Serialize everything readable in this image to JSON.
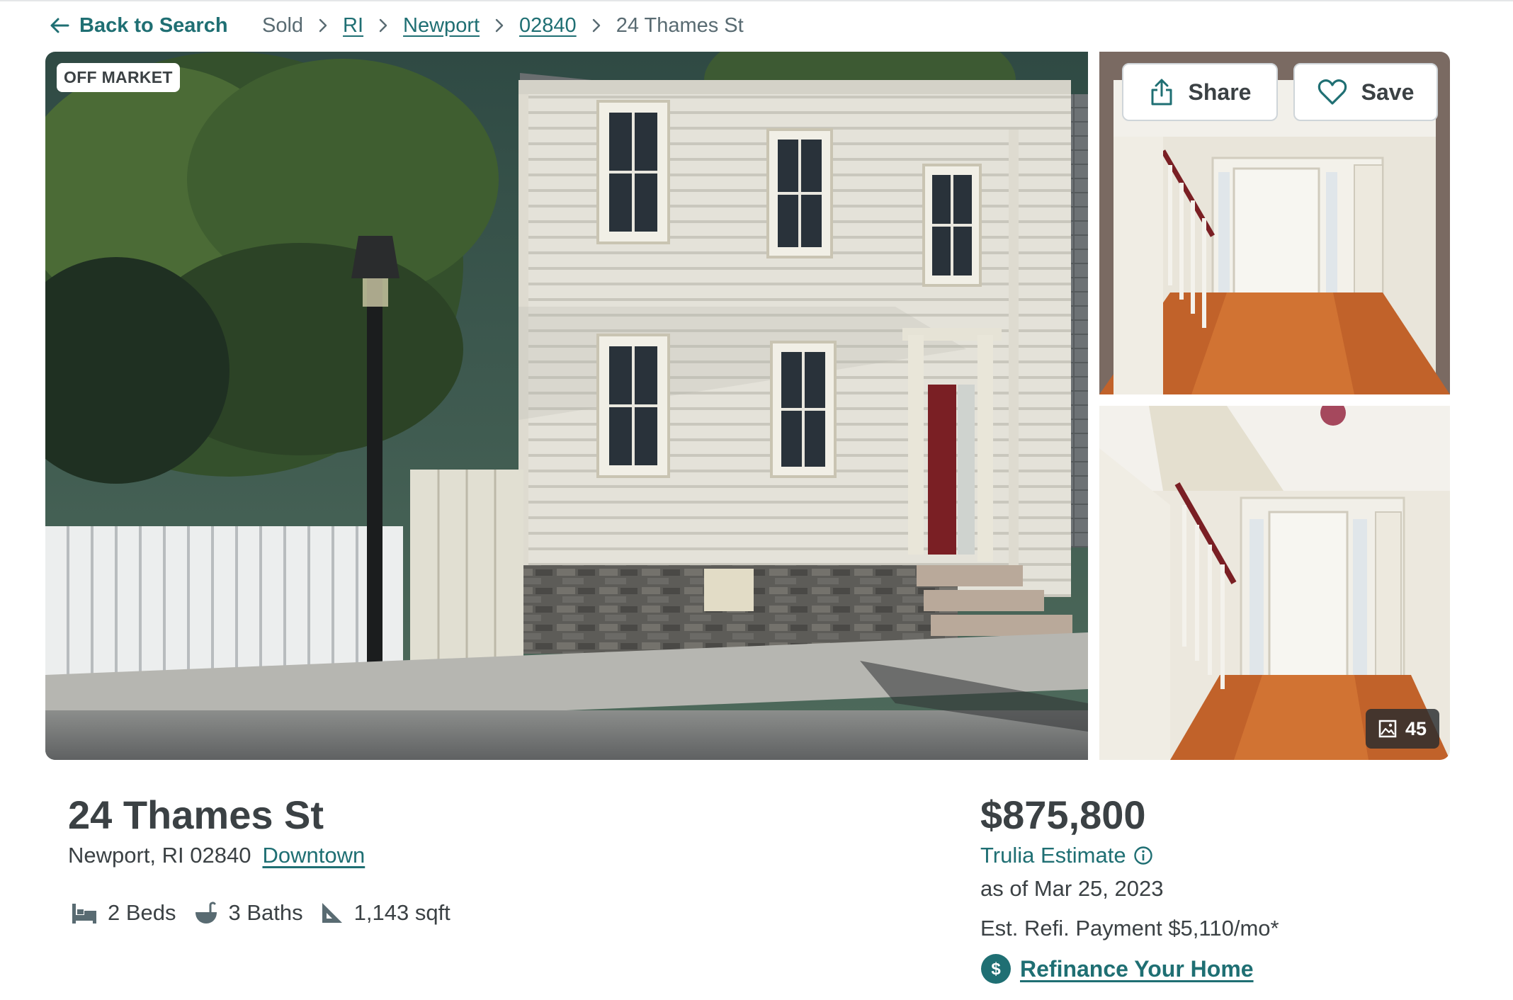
{
  "nav": {
    "back_label": "Back to Search",
    "breadcrumbs": [
      {
        "label": "Sold"
      },
      {
        "label": "RI"
      },
      {
        "label": "Newport"
      },
      {
        "label": "02840"
      },
      {
        "label": "24 Thames St"
      }
    ]
  },
  "gallery": {
    "status_badge": "OFF MARKET",
    "share_label": "Share",
    "save_label": "Save",
    "photo_count": "45"
  },
  "listing": {
    "address_line1": "24 Thames St",
    "address_line2": "Newport, RI 02840",
    "neighborhood": "Downtown",
    "beds": "2 Beds",
    "baths": "3 Baths",
    "sqft": "1,143 sqft"
  },
  "estimate": {
    "price": "$875,800",
    "label": "Trulia Estimate",
    "as_of": "as of Mar 25, 2023",
    "refi_payment": "Est. Refi. Payment $5,110/mo*",
    "refi_link": "Refinance Your Home"
  },
  "colors": {
    "accent": "#1f6f73",
    "text": "#3b4144"
  }
}
